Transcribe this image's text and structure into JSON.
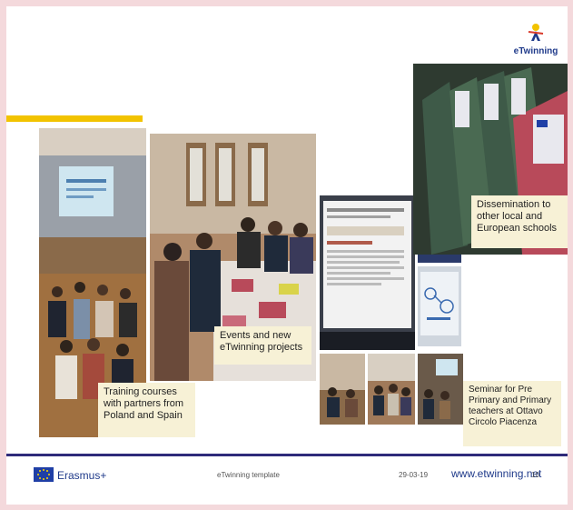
{
  "logo": {
    "text": "eTwinning"
  },
  "captions": {
    "training": "Training courses with partners from Poland and Spain",
    "events": "Events and new eTwinning projects",
    "dissemination": "Dissemination to other local and European schools",
    "seminar": "Seminar for Pre Primary and Primary teachers at Ottavo Circolo Piacenza"
  },
  "footer": {
    "erasmus": "Erasmus+",
    "template": "eTwinning template",
    "date": "29-03-19",
    "site": "www.etwinning.net",
    "page": "10"
  },
  "colors": {
    "accent_yellow": "#f2c300",
    "footer_line": "#2e2a7a",
    "brand_blue": "#1f3a8a"
  }
}
